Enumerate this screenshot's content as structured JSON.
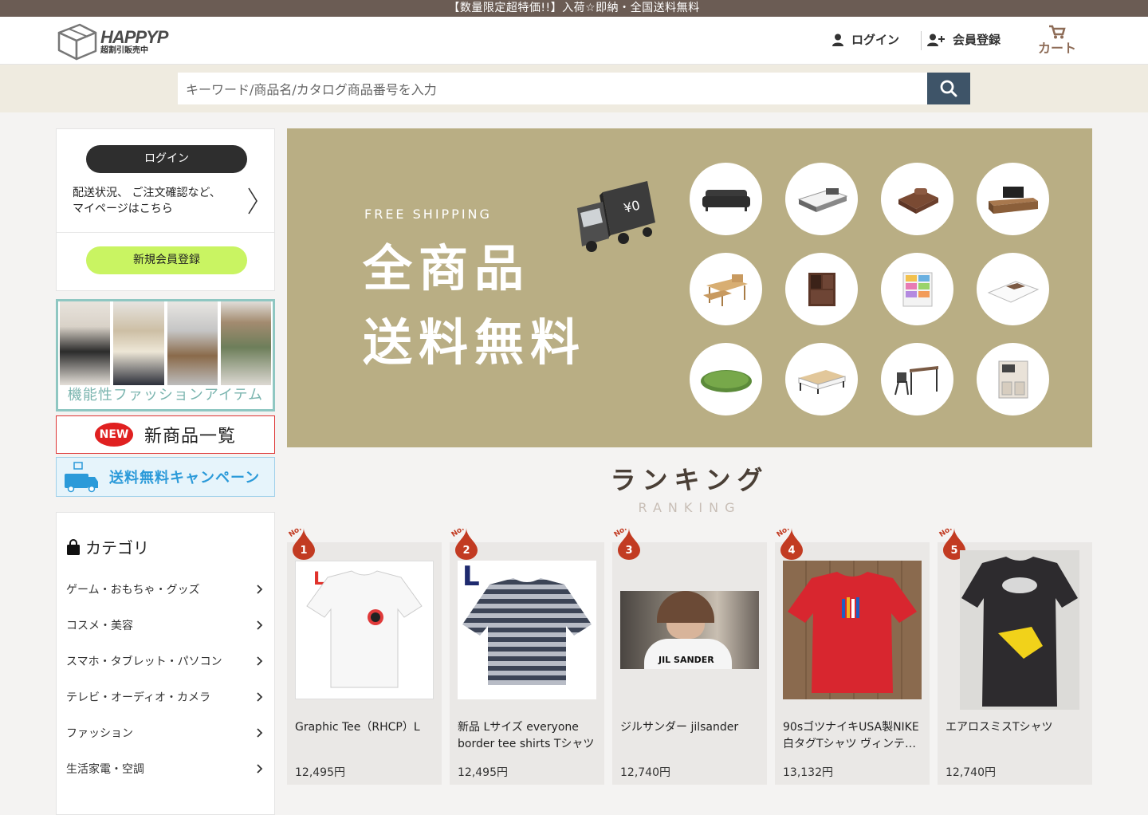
{
  "topbar": {
    "text": "【数量限定超特価!!】入荷☆即納・全国送料無料"
  },
  "header": {
    "logo_name": "HAPPYP",
    "logo_sub": "超割引販売中",
    "login_label": "ログイン",
    "register_label": "会員登録",
    "cart_label": "カート"
  },
  "search": {
    "placeholder": "キーワード/商品名/カタログ商品番号を入力"
  },
  "sidebar": {
    "login_button": "ログイン",
    "mypage_line1": "配送状況、 ご注文確認など、",
    "mypage_line2": "マイページはこちら",
    "register_button": "新規会員登録",
    "fashion_banner": "機能性ファッションアイテム",
    "new_badge": "NEW",
    "new_items": "新商品一覧",
    "shipping_banner": "送料無料キャンペーン",
    "category_title": "カテゴリ",
    "categories": [
      {
        "label": "ゲーム・おもちゃ・グッズ"
      },
      {
        "label": "コスメ・美容"
      },
      {
        "label": "スマホ・タブレット・パソコン"
      },
      {
        "label": "テレビ・オーディオ・カメラ"
      },
      {
        "label": "ファッション"
      },
      {
        "label": "生活家電・空調"
      }
    ]
  },
  "hero": {
    "free_shipping": "FREE SHIPPING",
    "line1": "全商品",
    "line2": "送料無料",
    "truck_label": "¥0"
  },
  "ranking": {
    "title": "ランキング",
    "subtitle": "RANKING",
    "no_label": "No.",
    "items": [
      {
        "rank": "1",
        "name": "Graphic Tee（RHCP）L",
        "price": "12,495円",
        "tag": "L"
      },
      {
        "rank": "2",
        "name": "新品 Lサイズ everyone border tee shirts Tシャツ",
        "price": "12,495円",
        "tag": "L"
      },
      {
        "rank": "3",
        "name": "ジルサンダー jilsander",
        "price": "12,740円",
        "tag": "JIL SANDER"
      },
      {
        "rank": "4",
        "name": "90sゴツナイキUSA製NIKE白タグTシャツ ヴィンテ…",
        "price": "13,132円"
      },
      {
        "rank": "5",
        "name": "エアロスミスTシャツ",
        "price": "12,740円"
      }
    ]
  },
  "colors": {
    "topbar": "#6b5c54",
    "search_button": "#3e5468",
    "register": "#c9f462",
    "hero_bg": "#b9ae84",
    "rank_badge": "#c23b22"
  }
}
